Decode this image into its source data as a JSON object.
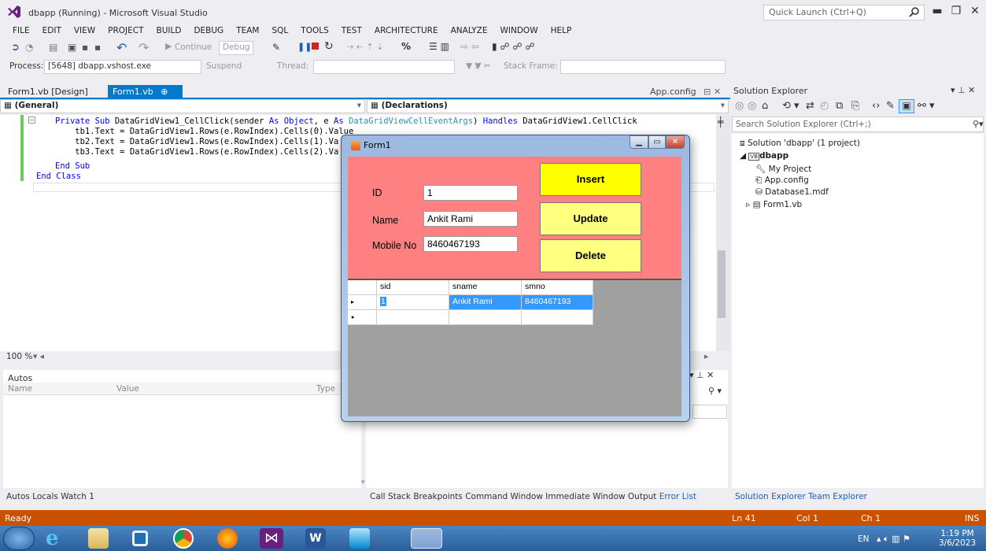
{
  "window": {
    "title": "dbapp (Running) - Microsoft Visual Studio",
    "quick_launch_placeholder": "Quick Launch (Ctrl+Q)"
  },
  "menu": [
    "FILE",
    "EDIT",
    "VIEW",
    "PROJECT",
    "BUILD",
    "DEBUG",
    "TEAM",
    "SQL",
    "TOOLS",
    "TEST",
    "ARCHITECTURE",
    "ANALYZE",
    "WINDOW",
    "HELP"
  ],
  "toolbar": {
    "continue_label": "Continue",
    "config_value": "Debug",
    "process_label": "Process:",
    "process_value": "[5648] dbapp.vshost.exe",
    "suspend_label": "Suspend",
    "thread_label": "Thread:",
    "stack_frame_label": "Stack Frame:"
  },
  "doc_tabs": {
    "design": "Form1.vb [Design]",
    "code": "Form1.vb",
    "code_pin": "⊕ ✕",
    "appconfig": "App.config"
  },
  "nav": {
    "left": "(General)",
    "right": "(Declarations)"
  },
  "code_lines": {
    "l1_a": "Private Sub ",
    "l1_b": "DataGridView1_CellClick(sender ",
    "l1_c": "As Object",
    "l1_d": ", e ",
    "l1_e": "As ",
    "l1_f": "DataGridViewCellEventArgs",
    "l1_g": ") ",
    "l1_h": "Handles ",
    "l1_i": "DataGridView1.CellClick",
    "l2": "    tb1.Text = DataGridView1.Rows(e.RowIndex).Cells(0).Value",
    "l3": "    tb2.Text = DataGridView1.Rows(e.RowIndex).Cells(1).Va",
    "l4": "    tb3.Text = DataGridView1.Rows(e.RowIndex).Cells(2).Va",
    "l5": "End Sub",
    "l6": "End Class"
  },
  "zoom": "100 %",
  "autos": {
    "title": "Autos",
    "col_name": "Name",
    "col_value": "Value",
    "col_type": "Type"
  },
  "bottom_tabs_left": "Autos  Locals  Watch 1",
  "bottom_tabs_mid": "Call Stack  Breakpoints  Command Window  Immediate Window  Output",
  "bottom_tab_error": "Error List",
  "solution_explorer": {
    "title": "Solution Explorer",
    "search_placeholder": "Search Solution Explorer (Ctrl+;)",
    "solution": "Solution 'dbapp' (1 project)",
    "project": "dbapp",
    "items": [
      "My Project",
      "App.config",
      "Database1.mdf",
      "Form1.vb"
    ],
    "bottom_tabs": "Solution Explorer  Team Explorer"
  },
  "status": {
    "ready": "Ready",
    "ln": "Ln 41",
    "col": "Col 1",
    "ch": "Ch 1",
    "ins": "INS"
  },
  "taskbar": {
    "lang": "EN",
    "time": "1:19 PM",
    "date": "3/6/2023"
  },
  "form1": {
    "title": "Form1",
    "labels": {
      "id": "ID",
      "name": "Name",
      "mobile": "Mobile No"
    },
    "values": {
      "id": "1",
      "name": "Ankit Rami",
      "mobile": "8460467193"
    },
    "buttons": {
      "insert": "Insert",
      "update": "Update",
      "delete": "Delete"
    },
    "colors": {
      "client": "#FF8080",
      "insert_btn": "#FFFF00",
      "other_btn": "#FFFF80"
    },
    "grid": {
      "columns": [
        "sid",
        "sname",
        "smno"
      ],
      "rows": [
        [
          "1",
          "Ankit Rami",
          "8460467193"
        ]
      ]
    }
  }
}
